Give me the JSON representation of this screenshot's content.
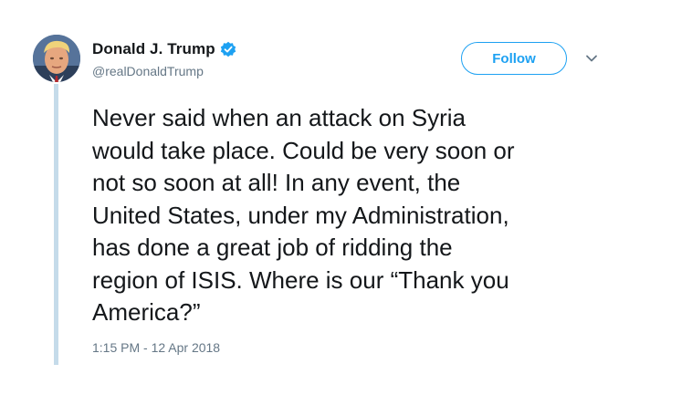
{
  "tweet": {
    "author": {
      "display_name": "Donald J. Trump",
      "handle": "@realDonaldTrump",
      "verified": true
    },
    "follow_label": "Follow",
    "menu_icon": "chevron-down-icon",
    "text": "Never said when an attack on Syria\nwould take place. Could be very soon or\nnot so soon at all! In any event, the\nUnited States, under my Administration,\nhas done a great job of ridding the\nregion of ISIS. Where is our “Thank you\nAmerica?”",
    "timestamp": "1:15 PM - 12 Apr 2018"
  },
  "colors": {
    "accent": "#1da1f2",
    "text": "#14171a",
    "muted": "#657786",
    "rule": "#c5dbea"
  }
}
